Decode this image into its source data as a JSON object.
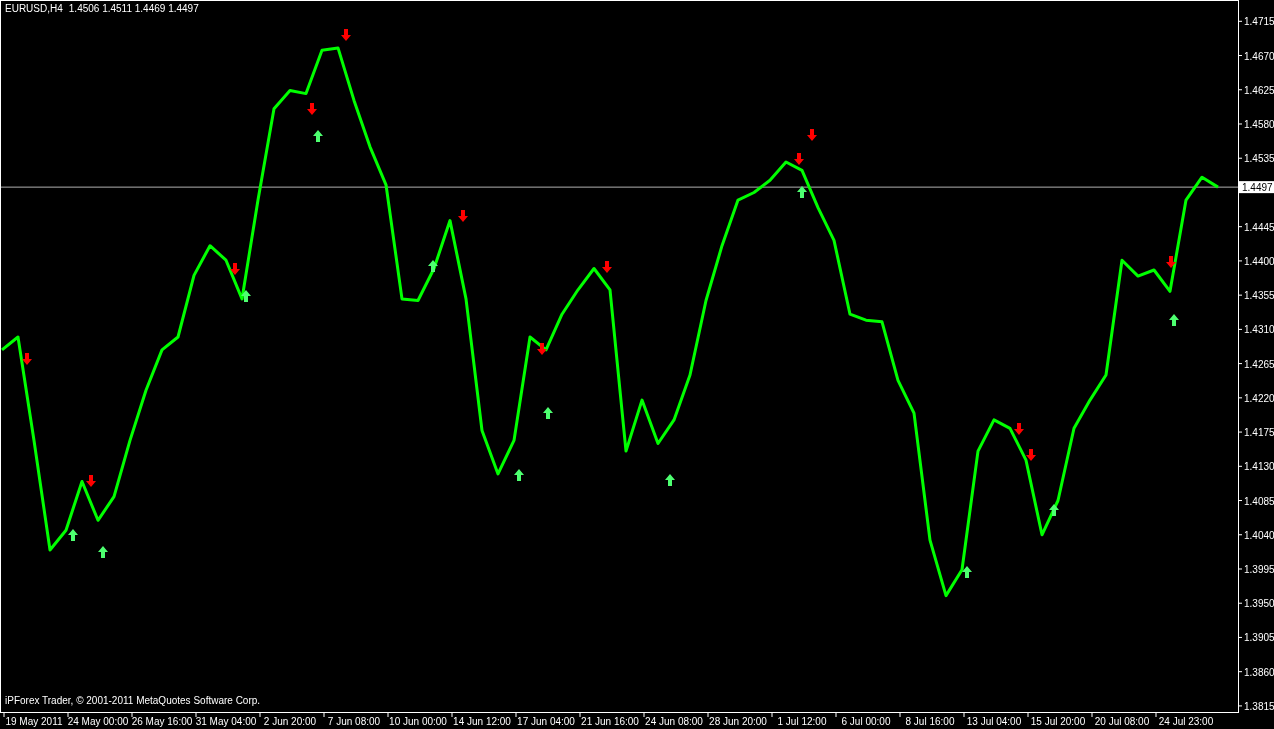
{
  "header": {
    "symbol": "EURUSD,H4",
    "quotes": "1.4506 1.4511 1.4469 1.4497"
  },
  "copyright": "iPForex Trader, © 2001-2011 MetaQuotes Software Corp.",
  "chart": {
    "chart_data": {
      "type": "line",
      "ylim": [
        1.3807,
        1.4743
      ],
      "categories": [
        null,
        null,
        "19 May 2011",
        null,
        null,
        null,
        "24 May 00:00",
        null,
        null,
        null,
        "26 May 16:00",
        null,
        null,
        null,
        "31 May 04:00",
        null,
        null,
        null,
        "2 Jun 20:00",
        null,
        null,
        null,
        "7 Jun 08:00",
        null,
        null,
        null,
        "10 Jun 00:00",
        null,
        null,
        null,
        "14 Jun 12:00",
        null,
        null,
        null,
        "17 Jun 04:00",
        null,
        null,
        null,
        "21 Jun 16:00",
        null,
        null,
        null,
        "24 Jun 08:00",
        null,
        null,
        null,
        "28 Jun 20:00",
        null,
        null,
        null,
        "1 Jul 12:00",
        null,
        null,
        null,
        "6 Jul 00:00",
        null,
        null,
        null,
        "8 Jul 16:00",
        null,
        null,
        null,
        "13 Jul 04:00",
        null,
        null,
        null,
        "15 Jul 20:00",
        null,
        null,
        null,
        "20 Jul 08:00",
        null,
        null,
        null,
        "24 Jul 23:00",
        null,
        null
      ],
      "series": [
        {
          "color": "#00ff00",
          "values": [
            1.4283,
            1.43,
            1.4164,
            1.402,
            1.4046,
            1.411,
            1.4059,
            1.409,
            1.4164,
            1.423,
            1.4283,
            1.43,
            1.4381,
            1.442,
            1.4401,
            1.435,
            1.448,
            1.46,
            1.4624,
            1.462,
            1.4677,
            1.468,
            1.4611,
            1.455,
            1.45,
            1.435,
            1.4348,
            1.439,
            1.4453,
            1.435,
            1.4177,
            1.412,
            1.4164,
            1.43,
            1.4283,
            1.433,
            1.4362,
            1.439,
            1.4362,
            1.415,
            1.4217,
            1.416,
            1.4191,
            1.425,
            1.4348,
            1.442,
            1.448,
            1.449,
            1.4506,
            1.453,
            1.4519,
            1.447,
            1.4427,
            1.433,
            1.4322,
            1.432,
            1.4243,
            1.42,
            1.4033,
            1.396,
            1.3994,
            1.415,
            1.4191,
            1.418,
            1.4138,
            1.404,
            1.4085,
            1.418,
            1.4217,
            1.425,
            1.4401,
            1.438,
            1.4388,
            1.436,
            1.448,
            1.451,
            1.4497
          ]
        }
      ],
      "yticks": [
        {
          "value": 1.4715,
          "label": "1.4715"
        },
        {
          "value": 1.467,
          "label": "1.4670"
        },
        {
          "value": 1.4625,
          "label": "1.4625"
        },
        {
          "value": 1.458,
          "label": "1.4580"
        },
        {
          "value": 1.4535,
          "label": "1.4535"
        },
        {
          "value": 1.4445,
          "label": "1.4445"
        },
        {
          "value": 1.44,
          "label": "1.4400"
        },
        {
          "value": 1.4355,
          "label": "1.4355"
        },
        {
          "value": 1.431,
          "label": "1.4310"
        },
        {
          "value": 1.4265,
          "label": "1.4265"
        },
        {
          "value": 1.422,
          "label": "1.4220"
        },
        {
          "value": 1.4175,
          "label": "1.4175"
        },
        {
          "value": 1.413,
          "label": "1.4130"
        },
        {
          "value": 1.4085,
          "label": "1.4085"
        },
        {
          "value": 1.404,
          "label": "1.4040"
        },
        {
          "value": 1.3995,
          "label": "1.3995"
        },
        {
          "value": 1.395,
          "label": "1.3950"
        },
        {
          "value": 1.3905,
          "label": "1.3905"
        },
        {
          "value": 1.386,
          "label": "1.3860"
        },
        {
          "value": 1.3815,
          "label": "1.3815"
        }
      ],
      "ref_lines": [
        {
          "axis": "y",
          "value": 1.4497,
          "label": "1.4497"
        }
      ]
    }
  }
}
